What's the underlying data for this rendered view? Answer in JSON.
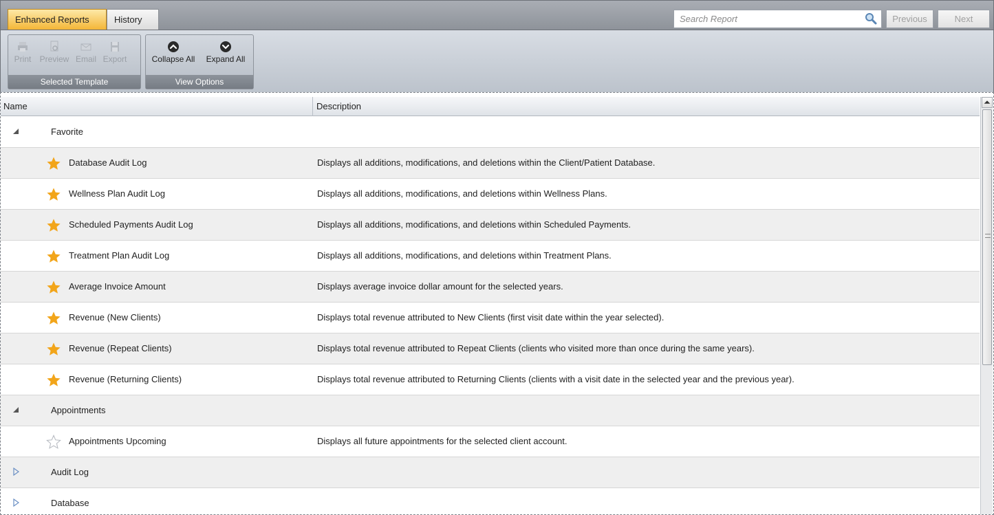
{
  "tabs": [
    {
      "label": "Enhanced Reports",
      "active": true
    },
    {
      "label": "History",
      "active": false
    }
  ],
  "search": {
    "placeholder": "Search Report",
    "icon": "magnifier-icon"
  },
  "nav": {
    "previous": "Previous",
    "next": "Next"
  },
  "ribbon": {
    "template_group": {
      "caption": "Selected Template",
      "buttons": [
        {
          "label": "Print",
          "icon": "printer-icon",
          "enabled": false
        },
        {
          "label": "Preview",
          "icon": "preview-icon",
          "enabled": false
        },
        {
          "label": "Email",
          "icon": "envelope-icon",
          "enabled": false
        },
        {
          "label": "Export",
          "icon": "floppy-disk-icon",
          "enabled": false
        }
      ]
    },
    "view_group": {
      "caption": "View Options",
      "buttons": [
        {
          "label": "Collapse All",
          "icon": "collapse-up-circle-icon",
          "enabled": true
        },
        {
          "label": "Expand All",
          "icon": "expand-down-circle-icon",
          "enabled": true
        }
      ]
    }
  },
  "grid": {
    "columns": {
      "name": "Name",
      "description": "Description"
    },
    "favorite": {
      "label": "Favorite",
      "expanded": true,
      "items": [
        {
          "name": "Database Audit Log",
          "description": "Displays all additions, modifications, and deletions within the Client/Patient Database."
        },
        {
          "name": "Wellness Plan Audit Log",
          "description": "Displays all additions, modifications, and deletions within Wellness Plans."
        },
        {
          "name": "Scheduled Payments Audit Log",
          "description": "Displays all additions, modifications, and deletions within Scheduled Payments."
        },
        {
          "name": "Treatment Plan Audit Log",
          "description": "Displays all additions, modifications, and deletions within Treatment Plans."
        },
        {
          "name": "Average Invoice Amount",
          "description": "Displays average invoice dollar amount for the selected years."
        },
        {
          "name": "Revenue (New Clients)",
          "description": "Displays total revenue attributed to New Clients (first visit date within the year selected)."
        },
        {
          "name": "Revenue (Repeat Clients)",
          "description": "Displays total revenue attributed to Repeat Clients (clients who visited more than once during the same years)."
        },
        {
          "name": "Revenue (Returning Clients)",
          "description": "Displays total revenue attributed to Returning Clients (clients with a visit date in the selected year and the previous year)."
        }
      ]
    },
    "appointments": {
      "label": "Appointments",
      "expanded": true,
      "items": [
        {
          "name": "Appointments Upcoming",
          "description": "Displays all future appointments for the selected client account."
        }
      ]
    },
    "audit_log": {
      "label": "Audit Log",
      "expanded": false
    },
    "database": {
      "label": "Database",
      "expanded": false
    }
  },
  "colors": {
    "favorite_star": "#f2a51a",
    "active_tab": "#f4b637"
  }
}
